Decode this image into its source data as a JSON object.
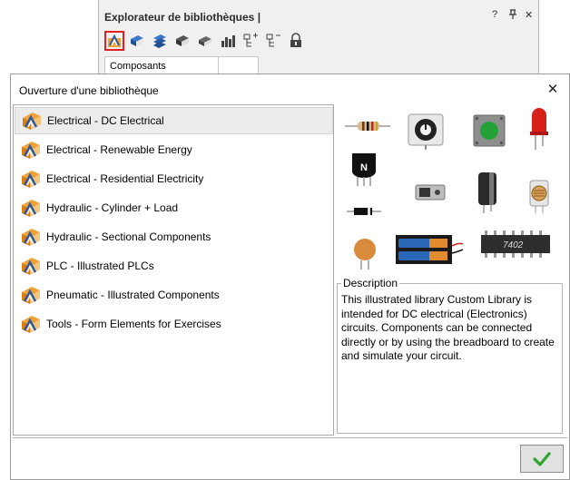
{
  "explorer": {
    "title": "Explorateur de bibliothèques |",
    "controls": {
      "help": "?",
      "pin": "⊥",
      "close": "✕"
    },
    "toolbar_icons": [
      "library-open-icon",
      "book-blue-icon",
      "book-stack-icon",
      "book-edit-icon",
      "book-grey-icon",
      "bar-chart-icon",
      "tree-add-icon",
      "tree-remove-icon",
      "lock-icon"
    ],
    "tab_label": "Composants génériques"
  },
  "dialog": {
    "title": "Ouverture d'une bibliothèque",
    "close_glyph": "✕",
    "libraries": [
      "Electrical - DC Electrical",
      "Electrical - Renewable Energy",
      "Electrical - Residential Electricity",
      "Hydraulic - Cylinder + Load",
      "Hydraulic - Sectional Components",
      "PLC - Illustrated PLCs",
      "Pneumatic - Illustrated Components",
      "Tools - Form Elements for Exercises"
    ],
    "selected_index": 0,
    "description_label": "Description",
    "description_text": "This illustrated library Custom Library is intended for DC electrical (Electronics) circuits. Components can be connected directly or by using the breadboard to create and simulate your circuit.",
    "preview": {
      "transistor_label": "N",
      "chip_label": "7402"
    },
    "ok_glyph": "✓"
  },
  "colors": {
    "accent_red": "#e02020",
    "ok_green": "#2fa52f",
    "selection_bg": "#ececec"
  }
}
